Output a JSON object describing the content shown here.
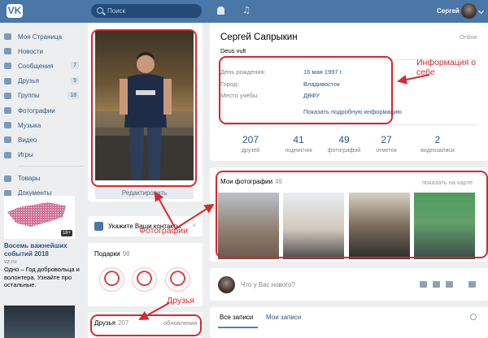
{
  "header": {
    "logo": "VK",
    "search_placeholder": "Поиск",
    "user_name": "Сергей"
  },
  "sidebar": {
    "items": [
      {
        "label": "Моя Страница",
        "icon": "home-icon"
      },
      {
        "label": "Новости",
        "icon": "news-icon"
      },
      {
        "label": "Сообщения",
        "icon": "messages-icon",
        "count": "7"
      },
      {
        "label": "Друзья",
        "icon": "friends-icon",
        "count": "9"
      },
      {
        "label": "Группы",
        "icon": "groups-icon",
        "count": "18"
      },
      {
        "label": "Фотографии",
        "icon": "photos-icon"
      },
      {
        "label": "Музыка",
        "icon": "music-icon"
      },
      {
        "label": "Видео",
        "icon": "video-icon"
      },
      {
        "label": "Игры",
        "icon": "games-icon"
      }
    ],
    "items2": [
      {
        "label": "Товары",
        "icon": "goods-icon"
      },
      {
        "label": "Документы",
        "icon": "documents-icon"
      }
    ],
    "ad": {
      "badge": "18+",
      "title": "Восемь важнейших событий 2018",
      "site": "vz.ru",
      "desc": "Одно – Год добровольца и волонтера. Узнайте про остальные."
    }
  },
  "profile_photo": {
    "edit_label": "Редактировать"
  },
  "contacts": {
    "label": "Укажите Ваши контакты",
    "close": "×"
  },
  "gifts": {
    "label": "Подарки",
    "count": "98"
  },
  "friends_block": {
    "label": "Друзья",
    "count": "207",
    "updates": "обновления"
  },
  "profile": {
    "name": "Сергей Сапрыкин",
    "status": "Deus vult",
    "online": "Online",
    "rows": [
      {
        "label": "День рождения:",
        "value": "16 мая 1997 г."
      },
      {
        "label": "Город:",
        "value": "Владивосток"
      },
      {
        "label": "Место учёбы:",
        "value": "ДВФУ"
      }
    ],
    "more": "Показать подробную информацию",
    "stats": [
      {
        "n": "207",
        "l": "друзей"
      },
      {
        "n": "41",
        "l": "подписчик"
      },
      {
        "n": "49",
        "l": "фотографий"
      },
      {
        "n": "27",
        "l": "отметок"
      },
      {
        "n": "2",
        "l": "видеозаписи"
      }
    ]
  },
  "photos": {
    "label": "Мои фотографии",
    "count": "49",
    "show_more": "показать на карте"
  },
  "post": {
    "placeholder": "Что у Вас нового?"
  },
  "wall": {
    "tab_all": "Все записи",
    "tab_mine": "Мои записи"
  },
  "annotations": {
    "info": "Информация о себе",
    "photos": "Фотографии",
    "friends": "Друзья",
    "color": "#d6282f"
  },
  "colors": {
    "header": "#4a76a8",
    "link": "#2a5885",
    "background": "#edeef0"
  }
}
